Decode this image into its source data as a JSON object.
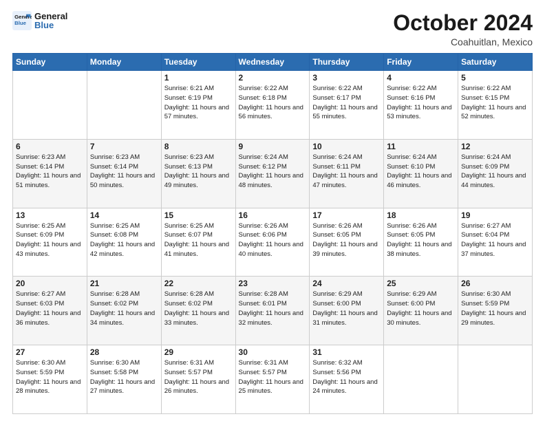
{
  "header": {
    "logo_general": "General",
    "logo_blue": "Blue",
    "month": "October 2024",
    "location": "Coahuitlan, Mexico"
  },
  "weekdays": [
    "Sunday",
    "Monday",
    "Tuesday",
    "Wednesday",
    "Thursday",
    "Friday",
    "Saturday"
  ],
  "weeks": [
    [
      {
        "day": "",
        "info": ""
      },
      {
        "day": "",
        "info": ""
      },
      {
        "day": "1",
        "info": "Sunrise: 6:21 AM\nSunset: 6:19 PM\nDaylight: 11 hours and 57 minutes."
      },
      {
        "day": "2",
        "info": "Sunrise: 6:22 AM\nSunset: 6:18 PM\nDaylight: 11 hours and 56 minutes."
      },
      {
        "day": "3",
        "info": "Sunrise: 6:22 AM\nSunset: 6:17 PM\nDaylight: 11 hours and 55 minutes."
      },
      {
        "day": "4",
        "info": "Sunrise: 6:22 AM\nSunset: 6:16 PM\nDaylight: 11 hours and 53 minutes."
      },
      {
        "day": "5",
        "info": "Sunrise: 6:22 AM\nSunset: 6:15 PM\nDaylight: 11 hours and 52 minutes."
      }
    ],
    [
      {
        "day": "6",
        "info": "Sunrise: 6:23 AM\nSunset: 6:14 PM\nDaylight: 11 hours and 51 minutes."
      },
      {
        "day": "7",
        "info": "Sunrise: 6:23 AM\nSunset: 6:14 PM\nDaylight: 11 hours and 50 minutes."
      },
      {
        "day": "8",
        "info": "Sunrise: 6:23 AM\nSunset: 6:13 PM\nDaylight: 11 hours and 49 minutes."
      },
      {
        "day": "9",
        "info": "Sunrise: 6:24 AM\nSunset: 6:12 PM\nDaylight: 11 hours and 48 minutes."
      },
      {
        "day": "10",
        "info": "Sunrise: 6:24 AM\nSunset: 6:11 PM\nDaylight: 11 hours and 47 minutes."
      },
      {
        "day": "11",
        "info": "Sunrise: 6:24 AM\nSunset: 6:10 PM\nDaylight: 11 hours and 46 minutes."
      },
      {
        "day": "12",
        "info": "Sunrise: 6:24 AM\nSunset: 6:09 PM\nDaylight: 11 hours and 44 minutes."
      }
    ],
    [
      {
        "day": "13",
        "info": "Sunrise: 6:25 AM\nSunset: 6:09 PM\nDaylight: 11 hours and 43 minutes."
      },
      {
        "day": "14",
        "info": "Sunrise: 6:25 AM\nSunset: 6:08 PM\nDaylight: 11 hours and 42 minutes."
      },
      {
        "day": "15",
        "info": "Sunrise: 6:25 AM\nSunset: 6:07 PM\nDaylight: 11 hours and 41 minutes."
      },
      {
        "day": "16",
        "info": "Sunrise: 6:26 AM\nSunset: 6:06 PM\nDaylight: 11 hours and 40 minutes."
      },
      {
        "day": "17",
        "info": "Sunrise: 6:26 AM\nSunset: 6:05 PM\nDaylight: 11 hours and 39 minutes."
      },
      {
        "day": "18",
        "info": "Sunrise: 6:26 AM\nSunset: 6:05 PM\nDaylight: 11 hours and 38 minutes."
      },
      {
        "day": "19",
        "info": "Sunrise: 6:27 AM\nSunset: 6:04 PM\nDaylight: 11 hours and 37 minutes."
      }
    ],
    [
      {
        "day": "20",
        "info": "Sunrise: 6:27 AM\nSunset: 6:03 PM\nDaylight: 11 hours and 36 minutes."
      },
      {
        "day": "21",
        "info": "Sunrise: 6:28 AM\nSunset: 6:02 PM\nDaylight: 11 hours and 34 minutes."
      },
      {
        "day": "22",
        "info": "Sunrise: 6:28 AM\nSunset: 6:02 PM\nDaylight: 11 hours and 33 minutes."
      },
      {
        "day": "23",
        "info": "Sunrise: 6:28 AM\nSunset: 6:01 PM\nDaylight: 11 hours and 32 minutes."
      },
      {
        "day": "24",
        "info": "Sunrise: 6:29 AM\nSunset: 6:00 PM\nDaylight: 11 hours and 31 minutes."
      },
      {
        "day": "25",
        "info": "Sunrise: 6:29 AM\nSunset: 6:00 PM\nDaylight: 11 hours and 30 minutes."
      },
      {
        "day": "26",
        "info": "Sunrise: 6:30 AM\nSunset: 5:59 PM\nDaylight: 11 hours and 29 minutes."
      }
    ],
    [
      {
        "day": "27",
        "info": "Sunrise: 6:30 AM\nSunset: 5:59 PM\nDaylight: 11 hours and 28 minutes."
      },
      {
        "day": "28",
        "info": "Sunrise: 6:30 AM\nSunset: 5:58 PM\nDaylight: 11 hours and 27 minutes."
      },
      {
        "day": "29",
        "info": "Sunrise: 6:31 AM\nSunset: 5:57 PM\nDaylight: 11 hours and 26 minutes."
      },
      {
        "day": "30",
        "info": "Sunrise: 6:31 AM\nSunset: 5:57 PM\nDaylight: 11 hours and 25 minutes."
      },
      {
        "day": "31",
        "info": "Sunrise: 6:32 AM\nSunset: 5:56 PM\nDaylight: 11 hours and 24 minutes."
      },
      {
        "day": "",
        "info": ""
      },
      {
        "day": "",
        "info": ""
      }
    ]
  ]
}
